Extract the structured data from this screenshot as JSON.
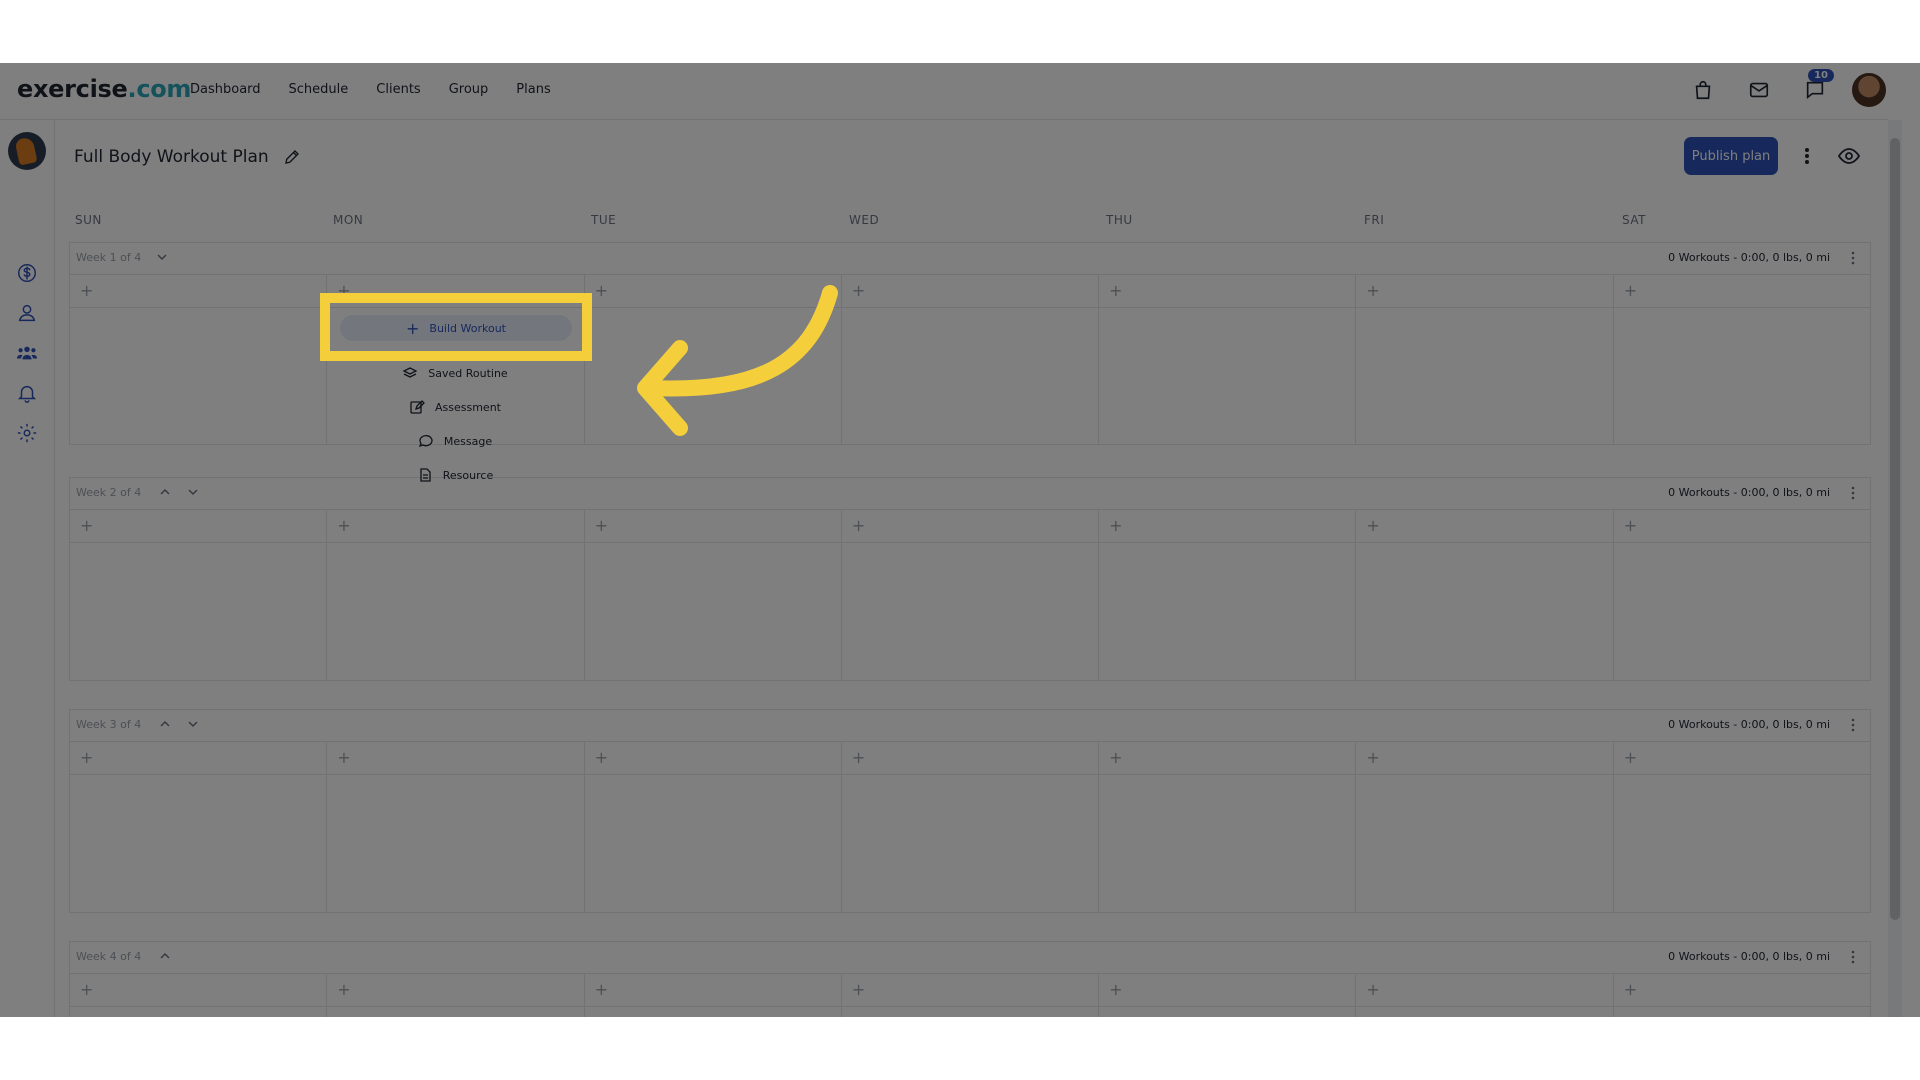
{
  "nav": {
    "logo_main": "exercise",
    "logo_accent": ".com",
    "links": [
      "Dashboard",
      "Schedule",
      "Clients",
      "Group",
      "Plans"
    ],
    "notification_count": "10"
  },
  "plan": {
    "title": "Full Body Workout Plan",
    "publish_label": "Publish plan"
  },
  "days": [
    "SUN",
    "MON",
    "TUE",
    "WED",
    "THU",
    "FRI",
    "SAT"
  ],
  "weeks": [
    {
      "label": "Week 1 of 4",
      "stats": "0 Workouts - 0:00, 0 lbs, 0 mi"
    },
    {
      "label": "Week 2 of 4",
      "stats": "0 Workouts - 0:00, 0 lbs, 0 mi"
    },
    {
      "label": "Week 3 of 4",
      "stats": "0 Workouts - 0:00, 0 lbs, 0 mi"
    },
    {
      "label": "Week 4 of 4",
      "stats": "0 Workouts - 0:00, 0 lbs, 0 mi"
    }
  ],
  "add_menu": {
    "build": "Build Workout",
    "saved": "Saved Routine",
    "assessment": "Assessment",
    "message": "Message",
    "resource": "Resource"
  },
  "plus_glyph": "+",
  "colors": {
    "primary": "#2f52b8",
    "highlight": "#f5cf3b",
    "accent_teal": "#2aa6b8"
  }
}
